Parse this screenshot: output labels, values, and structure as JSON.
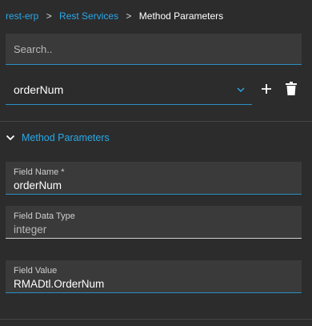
{
  "breadcrumb": {
    "items": [
      "rest-erp",
      "Rest Services"
    ],
    "separator": ">",
    "current": "Method Parameters"
  },
  "search": {
    "placeholder": "Search..",
    "value": ""
  },
  "selector": {
    "value": "orderNum",
    "icon": "chevron-down-icon"
  },
  "actions": {
    "add_icon": "plus-icon",
    "delete_icon": "trash-icon"
  },
  "section": {
    "title": "Method Parameters",
    "expanded": true
  },
  "fields": [
    {
      "label": "Field Name *",
      "value": "orderNum"
    },
    {
      "label": "Field Data Type",
      "value": "integer"
    },
    {
      "label": "Field Value",
      "value": "RMADtl.OrderNum"
    }
  ],
  "colors": {
    "background": "#2c2c2c",
    "field_background": "#3a3a3a",
    "accent": "#2aa8e8",
    "underline": "#2a8fc4"
  }
}
